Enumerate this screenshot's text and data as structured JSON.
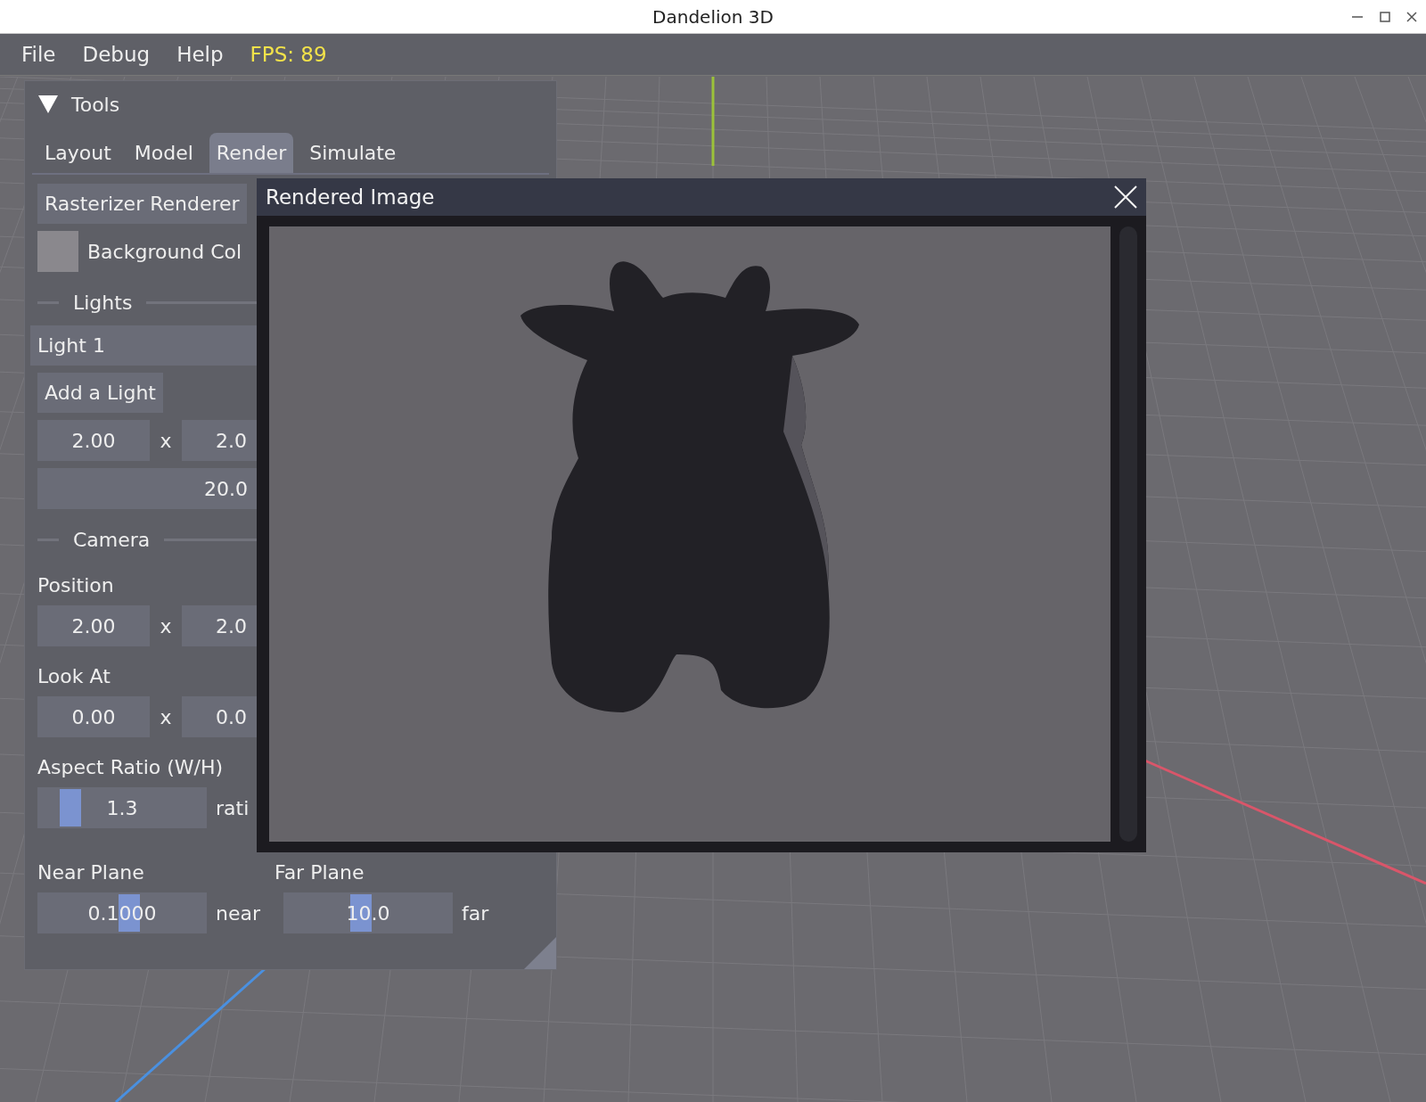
{
  "window": {
    "title": "Dandelion 3D"
  },
  "menu": {
    "items": [
      "File",
      "Debug",
      "Help"
    ],
    "fps": "FPS: 89"
  },
  "tools_panel": {
    "title": "Tools",
    "expanded": true,
    "tabs": [
      {
        "label": "Layout",
        "selected": false
      },
      {
        "label": "Model",
        "selected": false
      },
      {
        "label": "Render",
        "selected": true
      },
      {
        "label": "Simulate",
        "selected": false
      }
    ],
    "rows": [
      {
        "kind": "button",
        "label": "Rasterizer Renderer"
      },
      {
        "kind": "color",
        "label": "Background Col",
        "color": "#8a888d"
      },
      {
        "kind": "separator",
        "label": "Lights"
      },
      {
        "kind": "header",
        "label": "Light 1"
      },
      {
        "kind": "button",
        "label": "Add a Light"
      },
      {
        "kind": "vector",
        "values": [
          "2.00",
          "2.0"
        ],
        "joiner": "x"
      },
      {
        "kind": "wide",
        "value": "20.0"
      },
      {
        "kind": "separator",
        "label": "Camera"
      },
      {
        "kind": "label",
        "label": "Position"
      },
      {
        "kind": "vector",
        "values": [
          "2.00",
          "2.0"
        ],
        "joiner": "x"
      },
      {
        "kind": "label",
        "label": "Look At"
      },
      {
        "kind": "vector",
        "values": [
          "0.00",
          "0.0"
        ],
        "joiner": "x"
      },
      {
        "kind": "label",
        "label": "Aspect Ratio (W/H)"
      },
      {
        "kind": "sliders",
        "sliders": [
          {
            "value": "1.3",
            "suffix": "rati",
            "level": 0.15
          }
        ]
      },
      {
        "kind": "labels",
        "labels": [
          "Near Plane",
          "Far Plane"
        ]
      },
      {
        "kind": "sliders",
        "sliders": [
          {
            "value": "0.1000",
            "suffix": "near",
            "level": 0.55
          },
          {
            "value": "10.0",
            "suffix": "far",
            "level": 0.45
          }
        ]
      }
    ]
  },
  "render_window": {
    "title": "Rendered Image"
  }
}
